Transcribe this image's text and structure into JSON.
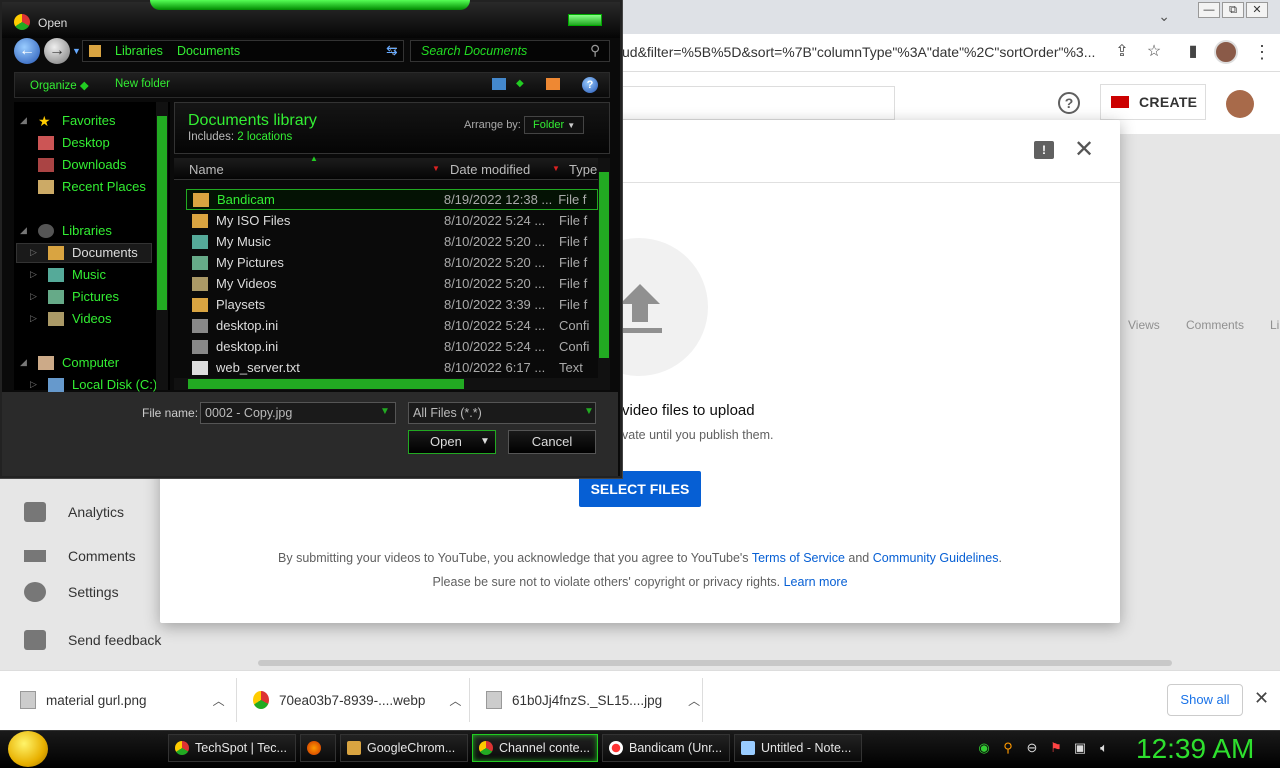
{
  "browser": {
    "url": "ud&filter=%5B%5D&sort=%7B\"columnType\"%3A\"date\"%2C\"sortOrder\"%3...",
    "win_min": "—",
    "win_restore": "⧉",
    "win_close": "✕"
  },
  "studio": {
    "create_label": "CREATE",
    "help_glyph": "?",
    "col_views": "Views",
    "col_comments": "Comments",
    "col_cut": "Li",
    "sidebar": [
      {
        "label": "Analytics"
      },
      {
        "label": "Comments"
      },
      {
        "label": "Settings"
      },
      {
        "label": "Send feedback"
      }
    ]
  },
  "upload_modal": {
    "drag_text": "video files to upload",
    "private_text": "vate until you publish them.",
    "select_button": "SELECT FILES",
    "tos_prefix": "By submitting your videos to YouTube, you acknowledge that you agree to YouTube's ",
    "tos_link": "Terms of Service",
    "tos_and": " and ",
    "guidelines_link": "Community Guidelines",
    "tos_end": ".",
    "rights_text": "Please be sure not to violate others' copyright or privacy rights. ",
    "learn_more": "Learn more",
    "feedback_glyph": "!",
    "close_glyph": "✕"
  },
  "downloads": {
    "items": [
      {
        "name": "material gurl.png"
      },
      {
        "name": "70ea03b7-8939-....webp"
      },
      {
        "name": "61b0Jj4fnzS._SL15....jpg"
      }
    ],
    "show_all": "Show all",
    "close_glyph": "✕"
  },
  "taskbar": {
    "tasks": [
      {
        "label": "TechSpot | Tec..."
      },
      {
        "label": ""
      },
      {
        "label": "GoogleChrom..."
      },
      {
        "label": "Channel conte..."
      },
      {
        "label": "Bandicam (Unr..."
      },
      {
        "label": "Untitled - Note..."
      }
    ],
    "clock": "12:39 AM"
  },
  "dialog": {
    "title": "Open",
    "breadcrumb": [
      "Libraries",
      "Documents"
    ],
    "search_placeholder": "Search Documents",
    "toolbar": {
      "organize": "Organize",
      "new_folder": "New folder",
      "help_glyph": "?"
    },
    "nav": {
      "favorites": "Favorites",
      "desktop": "Desktop",
      "downloads": "Downloads",
      "recent": "Recent Places",
      "libraries": "Libraries",
      "documents": "Documents",
      "music": "Music",
      "pictures": "Pictures",
      "videos": "Videos",
      "computer": "Computer",
      "local_disk": "Local Disk (C:)"
    },
    "library": {
      "title": "Documents library",
      "includes_label": "Includes:",
      "includes_link": "2 locations",
      "arrange_label": "Arrange by:",
      "arrange_value": "Folder"
    },
    "columns": {
      "name": "Name",
      "date": "Date modified",
      "type": "Type"
    },
    "files": [
      {
        "name": "Bandicam",
        "date": "8/19/2022 12:38 ...",
        "type": "File f",
        "kind": "folder"
      },
      {
        "name": "My ISO Files",
        "date": "8/10/2022 5:24 ...",
        "type": "File f",
        "kind": "folder"
      },
      {
        "name": "My Music",
        "date": "8/10/2022 5:20 ...",
        "type": "File f",
        "kind": "folder-music"
      },
      {
        "name": "My Pictures",
        "date": "8/10/2022 5:20 ...",
        "type": "File f",
        "kind": "folder-pictures"
      },
      {
        "name": "My Videos",
        "date": "8/10/2022 5:20 ...",
        "type": "File f",
        "kind": "folder-videos"
      },
      {
        "name": "Playsets",
        "date": "8/10/2022 3:39 ...",
        "type": "File f",
        "kind": "folder"
      },
      {
        "name": "desktop.ini",
        "date": "8/10/2022 5:24 ...",
        "type": "Confi",
        "kind": "ini"
      },
      {
        "name": "desktop.ini",
        "date": "8/10/2022 5:24 ...",
        "type": "Confi",
        "kind": "ini"
      },
      {
        "name": "web_server.txt",
        "date": "8/10/2022 6:17 ...",
        "type": "Text",
        "kind": "txt"
      }
    ],
    "filename_label": "File name:",
    "filename_value": "0002 - Copy.jpg",
    "filetype_value": "All Files (*.*)",
    "open_button": "Open",
    "cancel_button": "Cancel"
  },
  "colors": {
    "accent_green": "#33ee33",
    "yt_blue": "#065fd4",
    "clock_green": "#2ee02e"
  }
}
